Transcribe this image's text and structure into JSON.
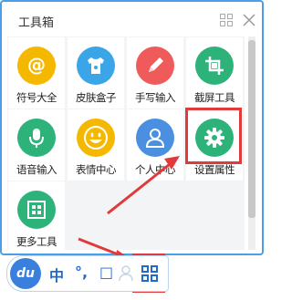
{
  "window": {
    "title": "工具箱"
  },
  "tools": [
    {
      "label": "符号大全",
      "icon": "at-sign-icon",
      "color": "#f5b800"
    },
    {
      "label": "皮肤盒子",
      "icon": "tshirt-icon",
      "color": "#3aa6e8"
    },
    {
      "label": "手写输入",
      "icon": "pencil-icon",
      "color": "#ef5a5a"
    },
    {
      "label": "截屏工具",
      "icon": "crop-icon",
      "color": "#2db37a"
    },
    {
      "label": "语音输入",
      "icon": "microphone-icon",
      "color": "#2db37a"
    },
    {
      "label": "表情中心",
      "icon": "smiley-icon",
      "color": "#f5b800"
    },
    {
      "label": "个人中心",
      "icon": "person-icon",
      "color": "#4a8fe0"
    },
    {
      "label": "设置属性",
      "icon": "gear-icon",
      "color": "#2db37a"
    },
    {
      "label": "更多工具",
      "icon": "grid-icon",
      "color": "#2db37a"
    }
  ],
  "status_bar": {
    "logo": "du",
    "lang": "中",
    "punct": "°,",
    "width_mode": "□",
    "toolbox_icon": "grid-icon"
  },
  "colors": {
    "accent": "#4a9fe8",
    "highlight": "#e03a3a"
  }
}
